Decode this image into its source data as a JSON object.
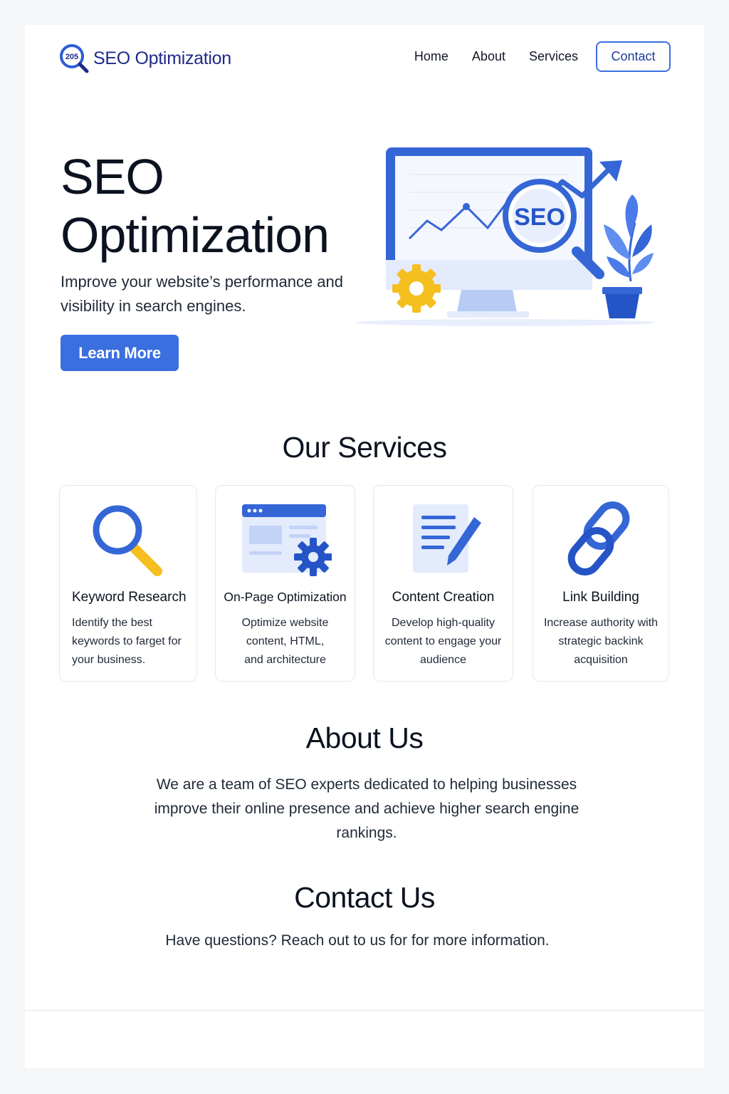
{
  "header": {
    "logo_badge": "205",
    "logo_text": "SEO Optimization",
    "nav": [
      "Home",
      "About",
      "Services"
    ],
    "contact_label": "Contact"
  },
  "hero": {
    "title_line1": "SEO",
    "title_line2": "Optimization",
    "subtitle": "Improve your website’s performance and visibility in search engines.",
    "button_label": "Learn More",
    "illustration_badge": "SEO"
  },
  "services": {
    "title": "Our Services",
    "items": [
      {
        "title": "Keyword Research",
        "desc": "Identify the best keywords to farget for your business.",
        "icon": "magnifier-icon"
      },
      {
        "title": "On-Page Optimization",
        "desc": "Optimize website content, HTML, and architecture",
        "icon": "webpage-gear-icon"
      },
      {
        "title": "Content Creation",
        "desc": "Develop high-quality content to engage your audience",
        "icon": "document-pen-icon"
      },
      {
        "title": "Link Building",
        "desc": "Increase authority with strategic backink acquisition",
        "icon": "chain-link-icon"
      }
    ]
  },
  "about": {
    "title": "About Us",
    "text": "We are a team of SEO experts dedicated to helping businesses improve their online presence and achieve higher search engine rankings."
  },
  "contact": {
    "title": "Contact Us",
    "text": "Have questions? Reach out to us for for more information."
  },
  "colors": {
    "primary": "#3b6fe0",
    "navy": "#1f2a8a",
    "accent": "#f5bf1f",
    "text": "#111827"
  }
}
